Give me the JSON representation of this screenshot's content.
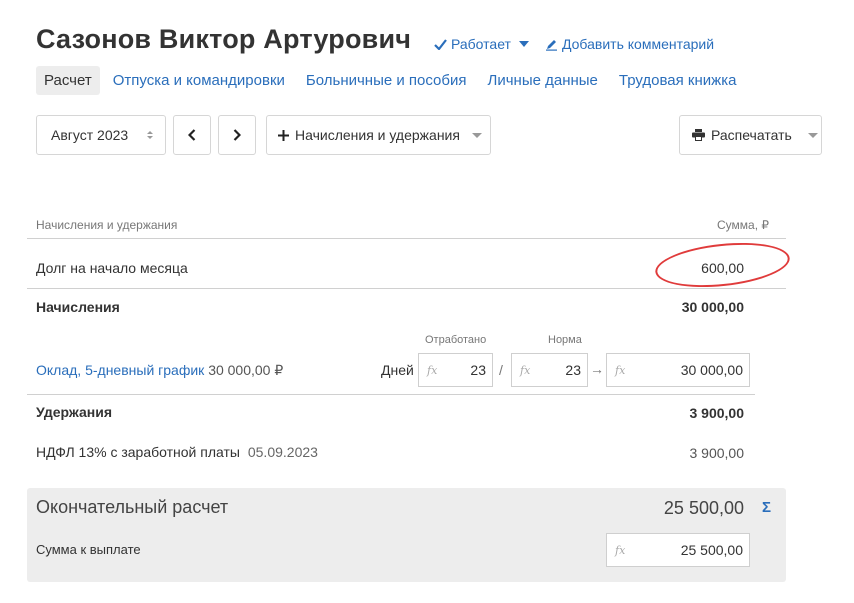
{
  "header": {
    "title": "Сазонов Виктор Артурович",
    "status_label": "Работает",
    "comment_label": "Добавить комментарий"
  },
  "tabs": [
    {
      "label": "Расчет",
      "active": true
    },
    {
      "label": "Отпуска и командировки"
    },
    {
      "label": "Больничные и пособия"
    },
    {
      "label": "Личные данные"
    },
    {
      "label": "Трудовая книжка"
    }
  ],
  "toolbar": {
    "month": "Август 2023",
    "add_label": "Начисления и удержания",
    "print_label": "Распечатать"
  },
  "table": {
    "col_left": "Начисления и удержания",
    "col_right": "Сумма, ₽",
    "debt_label": "Долг на начало месяца",
    "debt_value": "600,00",
    "accruals_label": "Начисления",
    "accruals_total": "30 000,00",
    "worked_label": "Отработано",
    "norm_label": "Норма",
    "salary_link": "Оклад, 5-дневный график",
    "salary_amount": "30 000,00 ₽",
    "days_label": "Дней",
    "worked_days": "23",
    "norm_days": "23",
    "salary_result": "30 000,00",
    "deductions_label": "Удержания",
    "deductions_total": "3 900,00",
    "ndfl_label": "НДФЛ 13% с заработной платы",
    "ndfl_date": "05.09.2023",
    "ndfl_value": "3 900,00"
  },
  "summary": {
    "title": "Окончательный расчет",
    "total": "25 500,00",
    "payout_label": "Сумма к выплате",
    "payout_value": "25 500,00"
  },
  "icons": {
    "fx": "fx",
    "sigma": "Σ",
    "separator": "/",
    "arrow": "→"
  },
  "colors": {
    "link": "#2a6ebb",
    "highlight": "#e03b3b"
  }
}
